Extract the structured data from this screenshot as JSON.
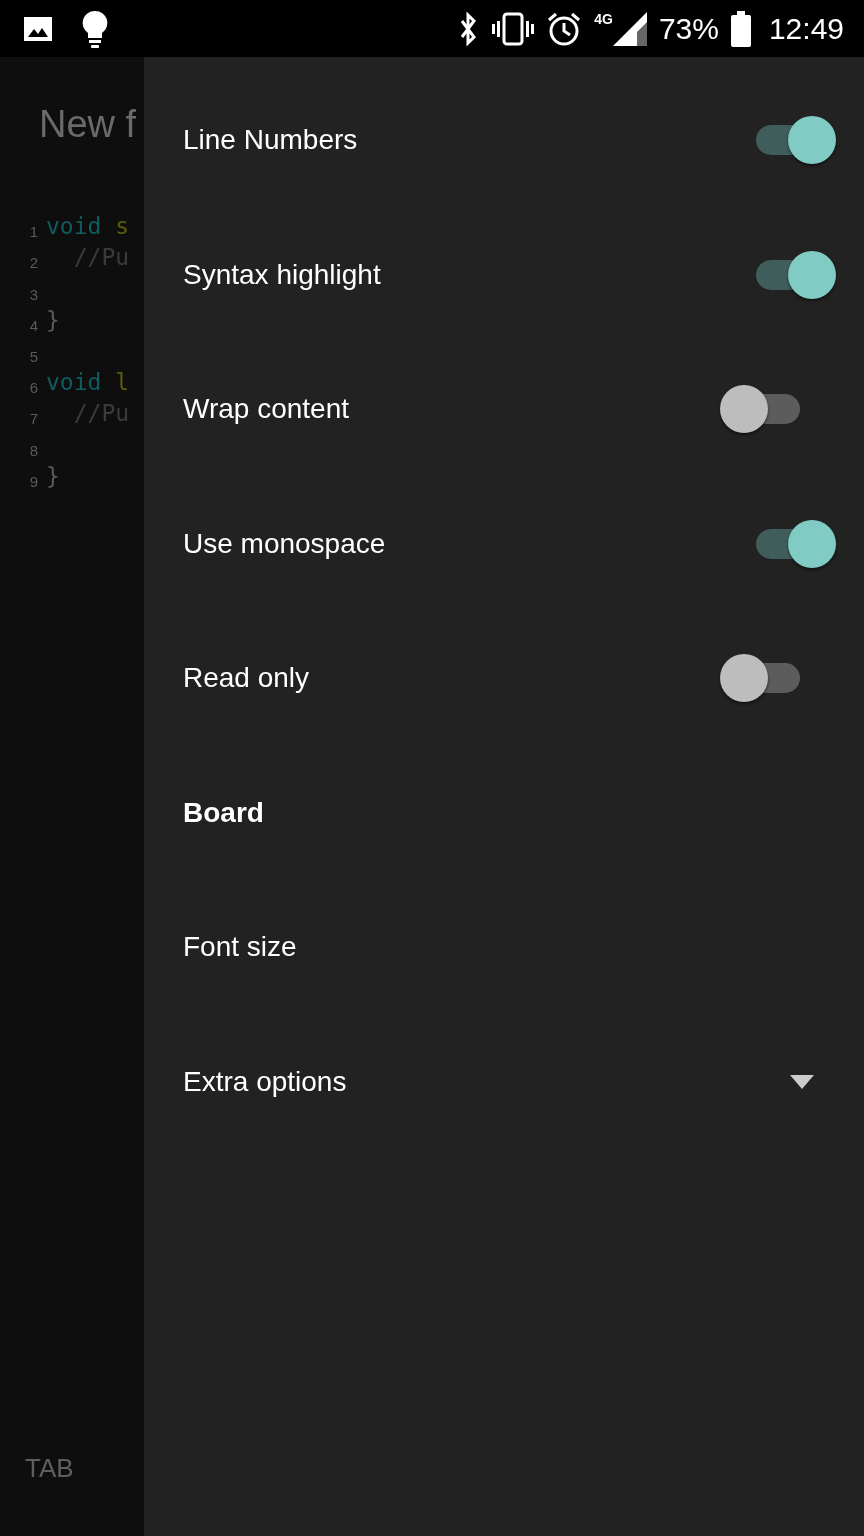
{
  "status_bar": {
    "network": "4G",
    "battery": "73%",
    "time": "12:49"
  },
  "editor": {
    "title": "New f",
    "lines": [
      {
        "number": "1",
        "tokens": [
          {
            "kind": "keyword",
            "text": "void"
          },
          {
            "kind": "function",
            "text": " s"
          }
        ]
      },
      {
        "number": "2",
        "tokens": [
          {
            "kind": "comment",
            "text": "  //Pu"
          }
        ]
      },
      {
        "number": "3"
      },
      {
        "number": "4",
        "tokens": [
          {
            "kind": "plain",
            "text": "}"
          }
        ]
      },
      {
        "number": "5"
      },
      {
        "number": "6",
        "tokens": [
          {
            "kind": "keyword",
            "text": "void"
          },
          {
            "kind": "function",
            "text": " l"
          }
        ]
      },
      {
        "number": "7",
        "tokens": [
          {
            "kind": "comment",
            "text": "  //Pu"
          }
        ]
      },
      {
        "number": "8"
      },
      {
        "number": "9",
        "tokens": [
          {
            "kind": "plain",
            "text": "}"
          }
        ]
      }
    ],
    "bottom_key": "TAB"
  },
  "drawer": {
    "items": [
      {
        "kind": "toggle",
        "label": "Line Numbers",
        "on": true
      },
      {
        "kind": "toggle",
        "label": "Syntax highlight",
        "on": true
      },
      {
        "kind": "toggle",
        "label": "Wrap content",
        "on": false
      },
      {
        "kind": "toggle",
        "label": "Use monospace",
        "on": true
      },
      {
        "kind": "toggle",
        "label": "Read only",
        "on": false
      },
      {
        "kind": "header",
        "label": "Board"
      },
      {
        "kind": "item",
        "label": "Font size"
      },
      {
        "kind": "dropdown",
        "label": "Extra options",
        "expanded": false
      }
    ]
  }
}
